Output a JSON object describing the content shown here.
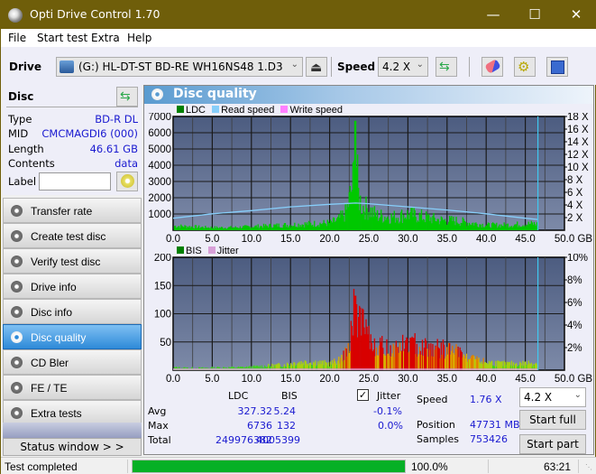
{
  "window": {
    "title": "Opti Drive Control 1.70",
    "min_icon": "minimize-icon",
    "max_icon": "maximize-icon",
    "close_icon": "close-icon"
  },
  "menu": [
    "File",
    "Start test",
    "Extra",
    "Help"
  ],
  "toolbar": {
    "drive_label": "Drive",
    "drive_value": "(G:)  HL-DT-ST BD-RE  WH16NS48 1.D3",
    "speed_label": "Speed",
    "speed_value": "4.2 X",
    "icons": [
      "drive-icon",
      "eject-icon",
      "refresh-icon",
      "eraser-icon",
      "settings-icon",
      "save-icon"
    ]
  },
  "disc": {
    "header": "Disc",
    "rows": [
      {
        "key": "Type",
        "value": "BD-R DL"
      },
      {
        "key": "MID",
        "value": "CMCMAGDI6 (000)"
      },
      {
        "key": "Length",
        "value": "46.61 GB"
      },
      {
        "key": "Contents",
        "value": "data"
      }
    ],
    "label_key": "Label",
    "label_value": ""
  },
  "nav": [
    {
      "label": "Transfer rate",
      "active": false
    },
    {
      "label": "Create test disc",
      "active": false
    },
    {
      "label": "Verify test disc",
      "active": false
    },
    {
      "label": "Drive info",
      "active": false
    },
    {
      "label": "Disc info",
      "active": false
    },
    {
      "label": "Disc quality",
      "active": true
    },
    {
      "label": "CD Bler",
      "active": false
    },
    {
      "label": "FE / TE",
      "active": false
    },
    {
      "label": "Extra tests",
      "active": false
    }
  ],
  "status_window_label": "Status window > >",
  "panel_title": "Disc quality",
  "colors": {
    "ldc": "#00c000",
    "read_speed": "#87cefa",
    "write_speed": "#ff80ff",
    "bis": "#008000",
    "jitter": "#d8a0d8",
    "active_nav": "#2e8ad8",
    "progress": "#06b025",
    "value_text": "#1a1ad0"
  },
  "chart_data": [
    {
      "type": "area",
      "title": "LDC / Read speed",
      "legend": [
        "LDC",
        "Read speed",
        "Write speed"
      ],
      "legend_placement": "top-left",
      "xlabel": "GB",
      "x_ticks": [
        "0.0",
        "5.0",
        "10.0",
        "15.0",
        "20.0",
        "25.0",
        "30.0",
        "35.0",
        "40.0",
        "45.0",
        "50.0 GB"
      ],
      "xlim": [
        0,
        50
      ],
      "y_left_ticks": [
        "1000",
        "2000",
        "3000",
        "4000",
        "5000",
        "6000",
        "7000"
      ],
      "ylim_left": [
        0,
        7000
      ],
      "y_right_ticks": [
        "2 X",
        "4 X",
        "6 X",
        "8 X",
        "10 X",
        "12 X",
        "14 X",
        "16 X",
        "18 X"
      ],
      "ylim_right": [
        0,
        18
      ],
      "end_marker_gb": 46.61,
      "series": [
        {
          "name": "LDC",
          "x": [
            0,
            2,
            4,
            6,
            8,
            10,
            12,
            14,
            16,
            18,
            20,
            21,
            22,
            22.5,
            23,
            23.2,
            23.4,
            23.6,
            24,
            25,
            26,
            28,
            30,
            32,
            34,
            36,
            38,
            40,
            42,
            44,
            46,
            46.6
          ],
          "values": [
            300,
            250,
            200,
            180,
            200,
            250,
            300,
            350,
            400,
            450,
            500,
            700,
            1200,
            2200,
            3500,
            6736,
            4200,
            2500,
            1700,
            1400,
            1000,
            900,
            1100,
            900,
            700,
            650,
            500,
            350,
            350,
            400,
            450,
            400
          ]
        },
        {
          "name": "Read speed",
          "x": [
            0,
            5,
            10,
            15,
            20,
            23.3,
            25,
            30,
            35,
            40,
            45,
            46.6
          ],
          "values": [
            1.9,
            2.6,
            3.1,
            3.7,
            4.1,
            4.3,
            4.2,
            3.7,
            3.2,
            2.6,
            1.9,
            1.7
          ]
        }
      ]
    },
    {
      "type": "bar",
      "title": "BIS / Jitter",
      "legend": [
        "BIS",
        "Jitter"
      ],
      "legend_placement": "top-left",
      "xlabel": "GB",
      "x_ticks": [
        "0.0",
        "5.0",
        "10.0",
        "15.0",
        "20.0",
        "25.0",
        "30.0",
        "35.0",
        "40.0",
        "45.0",
        "50.0 GB"
      ],
      "xlim": [
        0,
        50
      ],
      "y_left_ticks": [
        "50",
        "100",
        "150",
        "200"
      ],
      "ylim_left": [
        0,
        200
      ],
      "y_right_ticks": [
        "2%",
        "4%",
        "6%",
        "8%",
        "10%"
      ],
      "ylim_right": [
        0,
        10
      ],
      "end_marker_gb": 46.61,
      "series": [
        {
          "name": "BIS",
          "x": [
            0,
            2,
            4,
            6,
            8,
            10,
            12,
            14,
            16,
            18,
            20,
            21,
            22,
            22.5,
            23,
            23.2,
            23.5,
            24,
            25,
            26,
            28,
            30,
            32,
            34,
            36,
            38,
            40,
            42,
            44,
            46,
            46.6
          ],
          "values": [
            5,
            4,
            4,
            5,
            5,
            6,
            8,
            10,
            15,
            15,
            12,
            18,
            30,
            60,
            100,
            132,
            110,
            85,
            55,
            45,
            40,
            50,
            45,
            40,
            35,
            20,
            15,
            12,
            12,
            14,
            12
          ]
        }
      ]
    }
  ],
  "stats": {
    "col_ldc": "LDC",
    "col_bis": "BIS",
    "rows": [
      {
        "label": "Avg",
        "ldc": "327.32",
        "bis": "5.24",
        "jitter": "-0.1%"
      },
      {
        "label": "Max",
        "ldc": "6736",
        "bis": "132",
        "jitter": "0.0%"
      },
      {
        "label": "Total",
        "ldc": "249976382",
        "bis": "4005399"
      }
    ],
    "jitter_label": "Jitter",
    "jitter_checked": true,
    "speed_label": "Speed",
    "speed_value": "1.76 X",
    "position_label": "Position",
    "position_value": "47731 MB",
    "samples_label": "Samples",
    "samples_value": "753426",
    "speed_select": "4.2 X",
    "start_full": "Start full",
    "start_part": "Start part"
  },
  "statusbar": {
    "text": "Test completed",
    "progress": 100.0,
    "progress_text": "100.0%",
    "time": "63:21"
  }
}
